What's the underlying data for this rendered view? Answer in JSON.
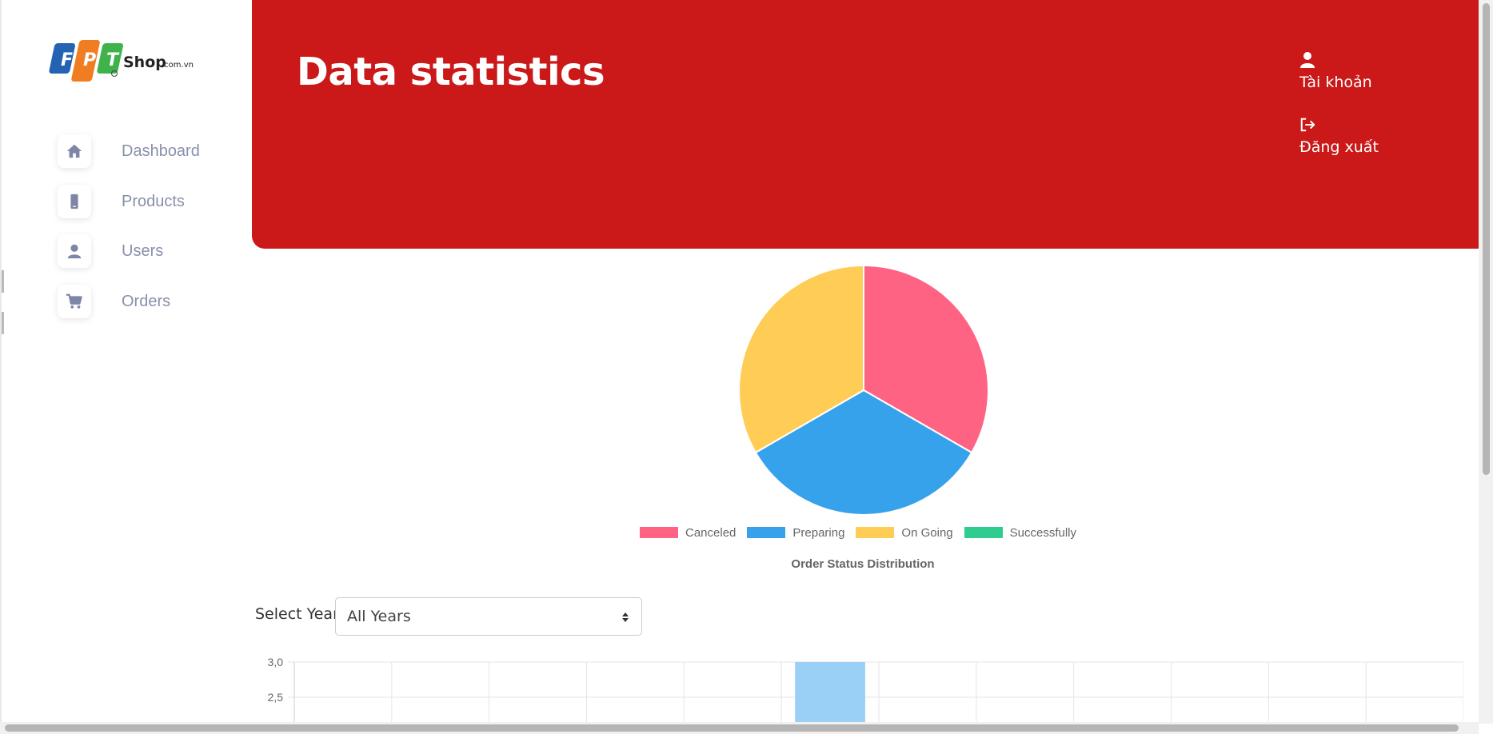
{
  "sidebar": {
    "logo": {
      "letters": [
        "F",
        "P",
        "T"
      ],
      "brand": "Shop",
      "domain": ".com.vn"
    },
    "items": [
      {
        "label": "Dashboard",
        "icon": "home-icon"
      },
      {
        "label": "Products",
        "icon": "mobile-phone-icon"
      },
      {
        "label": "Users",
        "icon": "user-icon"
      },
      {
        "label": "Orders",
        "icon": "shopping-cart-icon"
      }
    ]
  },
  "header": {
    "title": "Data statistics",
    "account_label": "Tài khoản",
    "account_icon": "user-icon",
    "logout_label": "Đăng xuất",
    "logout_icon": "sign-out-icon",
    "background_color": "#cb1818"
  },
  "filters": {
    "year_label": "Select Year:",
    "year_selected": "All Years"
  },
  "chart_data": [
    {
      "type": "pie",
      "title": "Order Status Distribution",
      "legend_position": "bottom",
      "categories": [
        "Canceled",
        "Preparing",
        "On Going",
        "Successfully"
      ],
      "values": [
        1,
        1,
        1,
        0
      ],
      "colors": [
        "#ff6384",
        "#36a2eb",
        "#ffcd56",
        "#2ecc8f"
      ]
    },
    {
      "type": "bar",
      "ytick_labels": [
        "3,0",
        "2,5"
      ],
      "ylim": [
        2.5,
        3.0
      ],
      "grid": true,
      "bar_color": "#9ad0f5",
      "partially_visible": true
    }
  ],
  "colors": {
    "accent_red": "#cb1818",
    "sidebar_text": "#8890ab"
  }
}
